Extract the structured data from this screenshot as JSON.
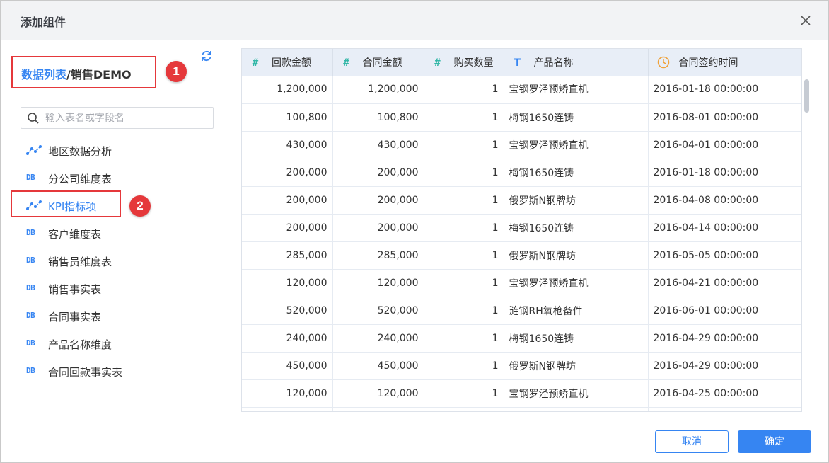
{
  "dialog": {
    "title": "添加组件"
  },
  "breadcrumb": {
    "link": "数据列表",
    "separator": "/",
    "current": "销售DEMO"
  },
  "badges": {
    "first": "1",
    "second": "2"
  },
  "search": {
    "placeholder": "输入表名或字段名"
  },
  "tree": [
    {
      "icon": "chart-link-icon",
      "label": "地区数据分析"
    },
    {
      "icon": "db-icon",
      "label": "分公司维度表"
    },
    {
      "icon": "chart-link-icon",
      "label": "KPI指标项"
    },
    {
      "icon": "db-icon",
      "label": "客户维度表"
    },
    {
      "icon": "db-icon",
      "label": "销售员维度表"
    },
    {
      "icon": "db-icon",
      "label": "销售事实表"
    },
    {
      "icon": "db-icon",
      "label": "合同事实表"
    },
    {
      "icon": "db-icon",
      "label": "产品名称维度"
    },
    {
      "icon": "db-icon",
      "label": "合同回款事实表"
    }
  ],
  "db_icon_text": "DB",
  "table": {
    "columns": [
      {
        "type_icon": "#",
        "label": "回款金额"
      },
      {
        "type_icon": "#",
        "label": "合同金额"
      },
      {
        "type_icon": "#",
        "label": "购买数量"
      },
      {
        "type_icon": "T",
        "label": "产品名称"
      },
      {
        "type_icon": "clock",
        "label": "合同签约时间"
      }
    ],
    "rows": [
      [
        "1,200,000",
        "1,200,000",
        "1",
        "宝钢罗泾预矫直机",
        "2016-01-18 00:00:00"
      ],
      [
        "100,800",
        "100,800",
        "1",
        "梅钢1650连铸",
        "2016-08-01 00:00:00"
      ],
      [
        "430,000",
        "430,000",
        "1",
        "宝钢罗泾预矫直机",
        "2016-04-01 00:00:00"
      ],
      [
        "200,000",
        "200,000",
        "1",
        "梅钢1650连铸",
        "2016-01-18 00:00:00"
      ],
      [
        "200,000",
        "200,000",
        "1",
        "俄罗斯N钢牌坊",
        "2016-04-08 00:00:00"
      ],
      [
        "200,000",
        "200,000",
        "1",
        "梅钢1650连铸",
        "2016-04-14 00:00:00"
      ],
      [
        "285,000",
        "285,000",
        "1",
        "俄罗斯N钢牌坊",
        "2016-05-05 00:00:00"
      ],
      [
        "120,000",
        "120,000",
        "1",
        "宝钢罗泾预矫直机",
        "2016-04-21 00:00:00"
      ],
      [
        "520,000",
        "520,000",
        "1",
        "涟钢RH氧枪备件",
        "2016-06-01 00:00:00"
      ],
      [
        "240,000",
        "240,000",
        "1",
        "梅钢1650连铸",
        "2016-04-29 00:00:00"
      ],
      [
        "450,000",
        "450,000",
        "1",
        "俄罗斯N钢牌坊",
        "2016-04-29 00:00:00"
      ],
      [
        "120,000",
        "120,000",
        "1",
        "宝钢罗泾预矫直机",
        "2016-04-25 00:00:00"
      ],
      [
        "",
        "",
        "",
        "",
        ""
      ]
    ]
  },
  "footer": {
    "cancel_label": "取消",
    "ok_label": "确定"
  },
  "colors": {
    "accent": "#3685f2",
    "annotation": "#e5383b",
    "number_type": "#32b7a7",
    "time_type": "#f0a23b"
  }
}
